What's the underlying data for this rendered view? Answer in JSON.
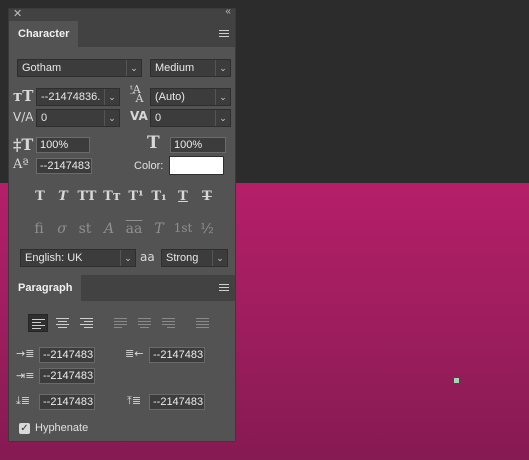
{
  "window": {
    "close_glyph": "✕",
    "collapse_glyph": "‹‹"
  },
  "character": {
    "tab_label": "Character",
    "font_family": "Gotham",
    "font_style": "Medium",
    "font_size": "--21474836.",
    "leading": "(Auto)",
    "kerning": "0",
    "tracking": "0",
    "vertical_scale": "100%",
    "horizontal_scale": "100%",
    "baseline_shift": "--2147483",
    "color_label": "Color:",
    "color_value": "#ffffff",
    "type_styles": [
      "T",
      "T",
      "TT",
      "Tт",
      "T¹",
      "T₁",
      "T",
      "T"
    ],
    "opentype": [
      "ﬁ",
      "σ",
      "st",
      "A",
      "aa",
      "T",
      "1st",
      "½"
    ],
    "language": "English: UK",
    "anti_alias": "Strong",
    "aa_icon": "aa"
  },
  "paragraph": {
    "tab_label": "Paragraph",
    "indent_left": "--2147483",
    "indent_right": "--2147483",
    "indent_first_line": "--2147483",
    "space_before": "--2147483",
    "space_after": "--2147483",
    "hyphenate_label": "Hyphenate",
    "hyphenate_checked": true,
    "check_glyph": "✓"
  }
}
